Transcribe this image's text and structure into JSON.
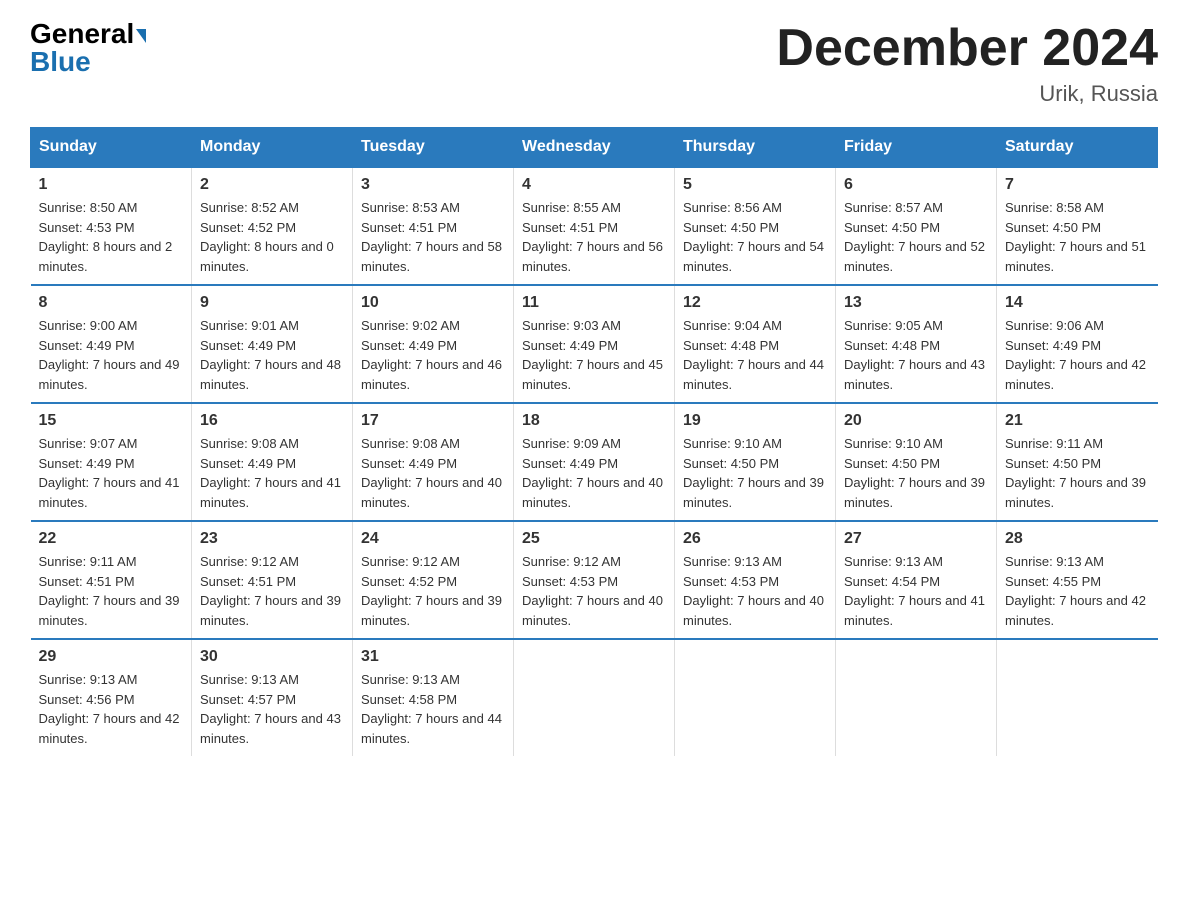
{
  "header": {
    "logo_line1": "General",
    "logo_line2": "Blue",
    "month_year": "December 2024",
    "location": "Urik, Russia"
  },
  "days_of_week": [
    "Sunday",
    "Monday",
    "Tuesday",
    "Wednesday",
    "Thursday",
    "Friday",
    "Saturday"
  ],
  "weeks": [
    [
      {
        "num": "1",
        "sunrise": "8:50 AM",
        "sunset": "4:53 PM",
        "daylight": "8 hours and 2 minutes."
      },
      {
        "num": "2",
        "sunrise": "8:52 AM",
        "sunset": "4:52 PM",
        "daylight": "8 hours and 0 minutes."
      },
      {
        "num": "3",
        "sunrise": "8:53 AM",
        "sunset": "4:51 PM",
        "daylight": "7 hours and 58 minutes."
      },
      {
        "num": "4",
        "sunrise": "8:55 AM",
        "sunset": "4:51 PM",
        "daylight": "7 hours and 56 minutes."
      },
      {
        "num": "5",
        "sunrise": "8:56 AM",
        "sunset": "4:50 PM",
        "daylight": "7 hours and 54 minutes."
      },
      {
        "num": "6",
        "sunrise": "8:57 AM",
        "sunset": "4:50 PM",
        "daylight": "7 hours and 52 minutes."
      },
      {
        "num": "7",
        "sunrise": "8:58 AM",
        "sunset": "4:50 PM",
        "daylight": "7 hours and 51 minutes."
      }
    ],
    [
      {
        "num": "8",
        "sunrise": "9:00 AM",
        "sunset": "4:49 PM",
        "daylight": "7 hours and 49 minutes."
      },
      {
        "num": "9",
        "sunrise": "9:01 AM",
        "sunset": "4:49 PM",
        "daylight": "7 hours and 48 minutes."
      },
      {
        "num": "10",
        "sunrise": "9:02 AM",
        "sunset": "4:49 PM",
        "daylight": "7 hours and 46 minutes."
      },
      {
        "num": "11",
        "sunrise": "9:03 AM",
        "sunset": "4:49 PM",
        "daylight": "7 hours and 45 minutes."
      },
      {
        "num": "12",
        "sunrise": "9:04 AM",
        "sunset": "4:48 PM",
        "daylight": "7 hours and 44 minutes."
      },
      {
        "num": "13",
        "sunrise": "9:05 AM",
        "sunset": "4:48 PM",
        "daylight": "7 hours and 43 minutes."
      },
      {
        "num": "14",
        "sunrise": "9:06 AM",
        "sunset": "4:49 PM",
        "daylight": "7 hours and 42 minutes."
      }
    ],
    [
      {
        "num": "15",
        "sunrise": "9:07 AM",
        "sunset": "4:49 PM",
        "daylight": "7 hours and 41 minutes."
      },
      {
        "num": "16",
        "sunrise": "9:08 AM",
        "sunset": "4:49 PM",
        "daylight": "7 hours and 41 minutes."
      },
      {
        "num": "17",
        "sunrise": "9:08 AM",
        "sunset": "4:49 PM",
        "daylight": "7 hours and 40 minutes."
      },
      {
        "num": "18",
        "sunrise": "9:09 AM",
        "sunset": "4:49 PM",
        "daylight": "7 hours and 40 minutes."
      },
      {
        "num": "19",
        "sunrise": "9:10 AM",
        "sunset": "4:50 PM",
        "daylight": "7 hours and 39 minutes."
      },
      {
        "num": "20",
        "sunrise": "9:10 AM",
        "sunset": "4:50 PM",
        "daylight": "7 hours and 39 minutes."
      },
      {
        "num": "21",
        "sunrise": "9:11 AM",
        "sunset": "4:50 PM",
        "daylight": "7 hours and 39 minutes."
      }
    ],
    [
      {
        "num": "22",
        "sunrise": "9:11 AM",
        "sunset": "4:51 PM",
        "daylight": "7 hours and 39 minutes."
      },
      {
        "num": "23",
        "sunrise": "9:12 AM",
        "sunset": "4:51 PM",
        "daylight": "7 hours and 39 minutes."
      },
      {
        "num": "24",
        "sunrise": "9:12 AM",
        "sunset": "4:52 PM",
        "daylight": "7 hours and 39 minutes."
      },
      {
        "num": "25",
        "sunrise": "9:12 AM",
        "sunset": "4:53 PM",
        "daylight": "7 hours and 40 minutes."
      },
      {
        "num": "26",
        "sunrise": "9:13 AM",
        "sunset": "4:53 PM",
        "daylight": "7 hours and 40 minutes."
      },
      {
        "num": "27",
        "sunrise": "9:13 AM",
        "sunset": "4:54 PM",
        "daylight": "7 hours and 41 minutes."
      },
      {
        "num": "28",
        "sunrise": "9:13 AM",
        "sunset": "4:55 PM",
        "daylight": "7 hours and 42 minutes."
      }
    ],
    [
      {
        "num": "29",
        "sunrise": "9:13 AM",
        "sunset": "4:56 PM",
        "daylight": "7 hours and 42 minutes."
      },
      {
        "num": "30",
        "sunrise": "9:13 AM",
        "sunset": "4:57 PM",
        "daylight": "7 hours and 43 minutes."
      },
      {
        "num": "31",
        "sunrise": "9:13 AM",
        "sunset": "4:58 PM",
        "daylight": "7 hours and 44 minutes."
      },
      null,
      null,
      null,
      null
    ]
  ]
}
